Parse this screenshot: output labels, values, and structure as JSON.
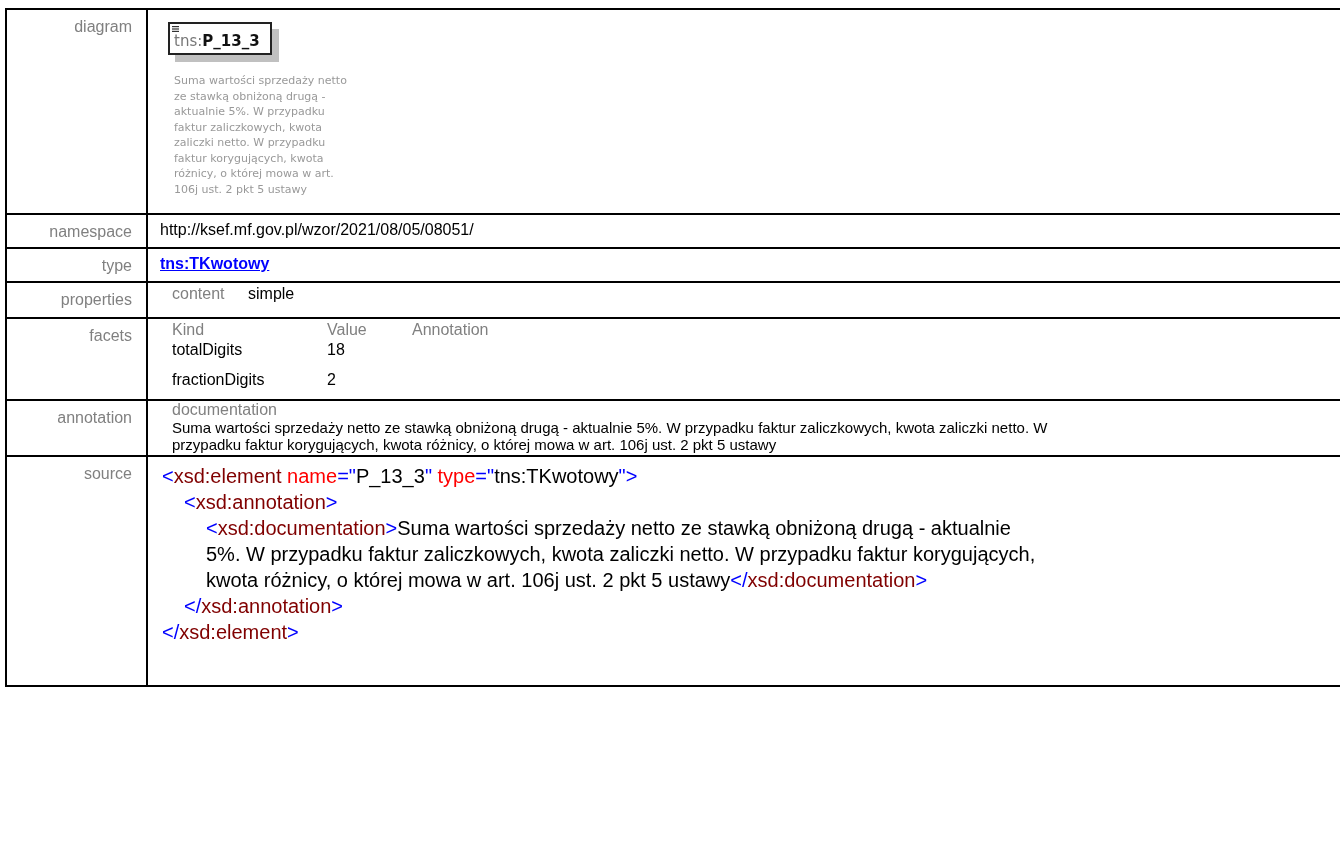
{
  "rows": [
    {
      "kind": "diagram",
      "label": "diagram",
      "prefix": "tns:",
      "name": "P_13_3",
      "description": "Suma wartości sprzedaży netto ze stawką obniżoną drugą - aktualnie 5%. W przypadku faktur zaliczkowych, kwota zaliczki netto. W przypadku faktur korygujących, kwota różnicy, o której mowa w art. 106j ust. 2 pkt 5 ustawy"
    },
    {
      "kind": "text",
      "label": "namespace",
      "value": "http://ksef.mf.gov.pl/wzor/2021/08/05/08051/"
    },
    {
      "kind": "link",
      "label": "type",
      "value": "tns:TKwotowy"
    },
    {
      "kind": "properties",
      "label": "properties",
      "items": [
        {
          "key": "content",
          "value": "simple"
        }
      ]
    },
    {
      "kind": "facets",
      "label": "facets",
      "columns": [
        "Kind",
        "Value",
        "Annotation"
      ],
      "items": [
        {
          "kind": "totalDigits",
          "value": "18"
        },
        {
          "kind": "fractionDigits",
          "value": "2"
        }
      ]
    },
    {
      "kind": "annotation",
      "label": "annotation",
      "heading": "documentation",
      "text": "Suma wartości sprzedaży netto ze stawką obniżoną drugą - aktualnie 5%. W przypadku faktur zaliczkowych, kwota zaliczki netto. W przypadku faktur korygujących, kwota różnicy, o której mowa w art. 106j ust. 2 pkt 5 ustawy"
    },
    {
      "kind": "source",
      "label": "source",
      "code": {
        "open": [
          {
            "kind": "punct",
            "text": "<"
          },
          {
            "kind": "tag",
            "text": "xsd:element"
          },
          {
            "kind": "attr",
            "text": " name"
          },
          {
            "kind": "punct",
            "text": "=\""
          },
          {
            "kind": "value",
            "text": "P_13_3"
          },
          {
            "kind": "punct",
            "text": "\""
          },
          {
            "kind": "attr",
            "text": " type"
          },
          {
            "kind": "punct",
            "text": "=\""
          },
          {
            "kind": "value",
            "text": "tns:TKwotowy"
          },
          {
            "kind": "punct",
            "text": "\">"
          }
        ],
        "children": [
          {
            "open": [
              {
                "kind": "punct",
                "text": "<"
              },
              {
                "kind": "tag",
                "text": "xsd:annotation"
              },
              {
                "kind": "punct",
                "text": ">"
              }
            ],
            "children": [
              {
                "open": [
                  {
                    "kind": "punct",
                    "text": "<"
                  },
                  {
                    "kind": "tag",
                    "text": "xsd:documentation"
                  },
                  {
                    "kind": "punct",
                    "text": ">"
                  },
                  {
                    "kind": "value",
                    "text": "Suma wartości sprzedaży netto ze stawką obniżoną drugą - aktualnie 5%. W przypadku faktur zaliczkowych, kwota zaliczki netto. W przypadku faktur korygujących, kwota różnicy, o której mowa w art. 106j ust. 2 pkt 5 ustawy"
                  },
                  {
                    "kind": "punct",
                    "text": "</"
                  },
                  {
                    "kind": "tag",
                    "text": "xsd:documentation"
                  },
                  {
                    "kind": "punct",
                    "text": ">"
                  }
                ]
              }
            ],
            "close": [
              {
                "kind": "punct",
                "text": "</"
              },
              {
                "kind": "tag",
                "text": "xsd:annotation"
              },
              {
                "kind": "punct",
                "text": ">"
              }
            ]
          }
        ],
        "close": [
          {
            "kind": "punct",
            "text": "</"
          },
          {
            "kind": "tag",
            "text": "xsd:element"
          },
          {
            "kind": "punct",
            "text": ">"
          }
        ]
      }
    }
  ]
}
